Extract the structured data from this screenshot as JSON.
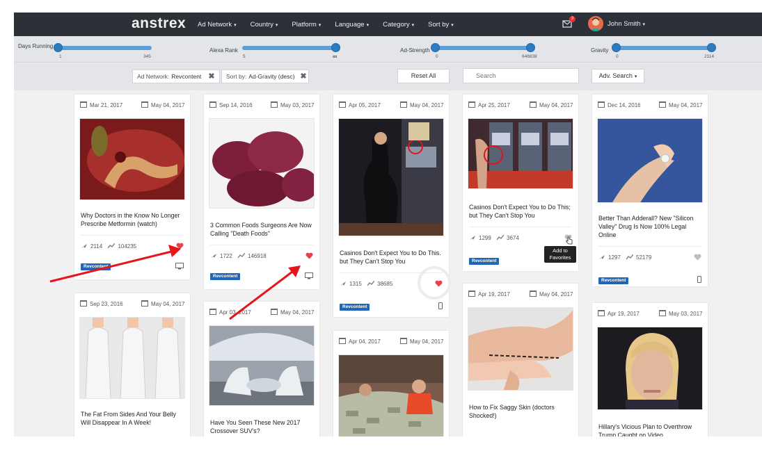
{
  "header": {
    "brand": "anstrex",
    "nav": [
      {
        "label": "Ad Network"
      },
      {
        "label": "Country"
      },
      {
        "label": "Platform"
      },
      {
        "label": "Language"
      },
      {
        "label": "Category"
      },
      {
        "label": "Sort by"
      }
    ],
    "notification_count": "3",
    "user_name": "John Smith",
    "caret": "▾"
  },
  "sliders": [
    {
      "label": "Days Running",
      "min": "1",
      "max": "345",
      "value_low": 1,
      "value_high": 345
    },
    {
      "label": "Alexa Rank",
      "min": "5",
      "max": "∞"
    },
    {
      "label": "Ad-Strength",
      "min": "0",
      "max": "646838"
    },
    {
      "label": "Gravity",
      "min": "0",
      "max": "2114"
    }
  ],
  "filters": {
    "chip1_key": "Ad Network:",
    "chip1_value": "Revcontent",
    "chip2_key": "Sort by:",
    "chip2_value": "Ad-Gravity (desc)",
    "remove": "✖",
    "reset": "Reset All",
    "search_placeholder": "Search",
    "adv_search": "Adv. Search"
  },
  "cards": [
    {
      "first_seen": "Mar 21, 2017",
      "last_seen": "May 04, 2017",
      "title": "Why Doctors in the Know No Longer Prescribe Metformin (watch)",
      "impressions": "2114",
      "strength": "104235",
      "network": "Revcontent",
      "favorited": true
    },
    {
      "first_seen": "Sep 23, 2016",
      "last_seen": "May 04, 2017",
      "title": "The Fat From Sides And Your Belly Will Disappear In A Week!"
    },
    {
      "first_seen": "Sep 14, 2016",
      "last_seen": "May 03, 2017",
      "title": "3 Common Foods Surgeons Are Now Calling \"Death Foods\"",
      "impressions": "1722",
      "strength": "146918",
      "network": "Revcontent",
      "favorited": true
    },
    {
      "first_seen": "Apr 03, 2017",
      "last_seen": "May 04, 2017",
      "title": "Have You Seen These New 2017 Crossover SUV's?"
    },
    {
      "first_seen": "Apr 05, 2017",
      "last_seen": "May 04, 2017",
      "title": "Casinos Don't Expect You to Do This. but They Can't Stop You",
      "impressions": "1315",
      "strength": "38685",
      "network": "Revcontent",
      "favorited": true
    },
    {
      "first_seen": "Apr 04, 2017",
      "last_seen": "May 04, 2017"
    },
    {
      "first_seen": "Apr 25, 2017",
      "last_seen": "May 04, 2017",
      "title": "Casinos Don't Expect You to Do This; but They Can't Stop You",
      "impressions": "1299",
      "strength": "3674",
      "network": "Revcontent",
      "favorited": false,
      "tooltip": "Add to Favorites"
    },
    {
      "first_seen": "Apr 19, 2017",
      "last_seen": "May 04, 2017",
      "title": "How to Fix Saggy Skin (doctors Shocked!)"
    },
    {
      "first_seen": "Dec 14, 2016",
      "last_seen": "May 04, 2017",
      "title": "Better Than Adderall? New \"Silicon Valley\" Drug Is Now 100% Legal Online",
      "impressions": "1297",
      "strength": "52179",
      "network": "Revcontent",
      "favorited": false
    },
    {
      "first_seen": "Apr 19, 2017",
      "last_seen": "May 03, 2017",
      "title": "Hillary's Vicious Plan to Overthrow Trump Caught on Video"
    }
  ],
  "colors": {
    "topbar": "#2c3037",
    "accent": "#2d7cc0",
    "heart_active": "#e8414c",
    "tag": "#2166b6",
    "annotation_arrow": "#e8141b"
  }
}
